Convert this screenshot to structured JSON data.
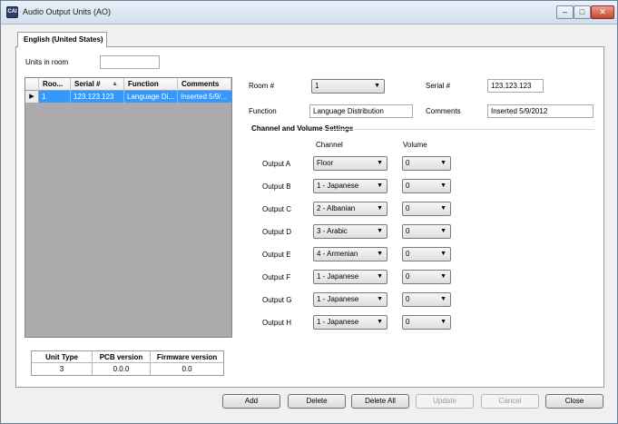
{
  "window": {
    "title": "Audio Output Units (AO)",
    "icon": "app-logo-icon"
  },
  "tabs": [
    {
      "label": "English (United States)"
    }
  ],
  "units_in_room": {
    "label": "Units in room",
    "value": ""
  },
  "grid": {
    "headers": [
      "Roo...",
      "Serial #",
      "Function",
      "Comments"
    ],
    "rows": [
      {
        "room": "1",
        "serial": "123.123.123",
        "function": "Language Di...",
        "comments": "Inserted 5/9/..."
      }
    ]
  },
  "form": {
    "room_label": "Room #",
    "room_value": "1",
    "serial_label": "Serial #",
    "serial_value": "123.123.123",
    "function_label": "Function",
    "function_value": "Language Distribution",
    "comments_label": "Comments",
    "comments_value": "Inserted 5/9/2012"
  },
  "channel_settings": {
    "title": "Channel and Volume Settings",
    "channel_header": "Channel",
    "volume_header": "Volume",
    "outputs": [
      {
        "label": "Output A",
        "channel": "Floor",
        "volume": "0"
      },
      {
        "label": "Output B",
        "channel": "1 - Japanese",
        "volume": "0"
      },
      {
        "label": "Output C",
        "channel": "2 - Albanian",
        "volume": "0"
      },
      {
        "label": "Output D",
        "channel": "3 - Arabic",
        "volume": "0"
      },
      {
        "label": "Output E",
        "channel": "4 - Armenian",
        "volume": "0"
      },
      {
        "label": "Output F",
        "channel": "1 - Japanese",
        "volume": "0"
      },
      {
        "label": "Output G",
        "channel": "1 - Japanese",
        "volume": "0"
      },
      {
        "label": "Output H",
        "channel": "1 - Japanese",
        "volume": "0"
      }
    ]
  },
  "unit_info": {
    "headers": [
      "Unit Type",
      "PCB version",
      "Firmware version"
    ],
    "values": [
      "3",
      "0.0.0",
      "0.0"
    ]
  },
  "buttons": {
    "add": "Add",
    "delete": "Delete",
    "delete_all": "Delete All",
    "update": "Update",
    "cancel": "Cancel",
    "close": "Close"
  }
}
